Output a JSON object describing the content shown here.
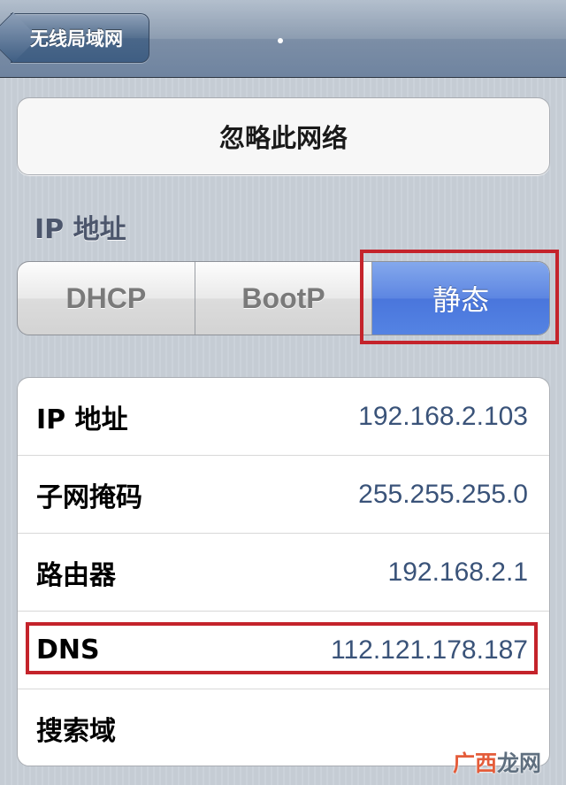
{
  "navbar": {
    "back_label": "无线局域网"
  },
  "forget_button": "忽略此网络",
  "ip_section_header": "IP 地址",
  "segments": [
    "DHCP",
    "BootP",
    "静态"
  ],
  "selected_segment": "静态",
  "fields": [
    {
      "label": "IP 地址",
      "value": "192.168.2.103"
    },
    {
      "label": "子网掩码",
      "value": "255.255.255.0"
    },
    {
      "label": "路由器",
      "value": "192.168.2.1"
    },
    {
      "label": "DNS",
      "value": "112.121.178.187"
    },
    {
      "label": "搜索域",
      "value": ""
    }
  ],
  "watermark": {
    "part1": "广西",
    "part2": "龙网"
  },
  "colors": {
    "selected_segment": "#5a84e2",
    "highlight_box": "#c4232b",
    "value_text": "#3a5379"
  }
}
